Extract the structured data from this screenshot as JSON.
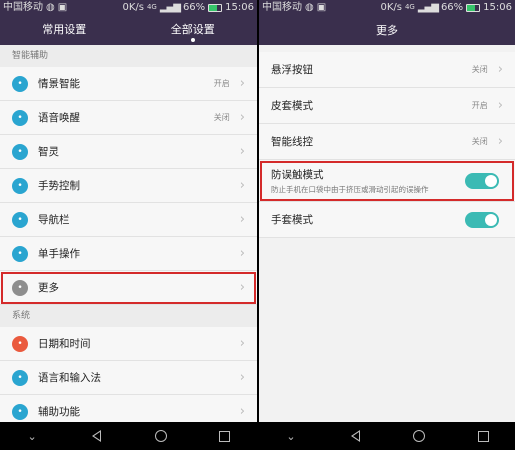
{
  "status": {
    "carrier": "中国移动",
    "speed": "0K/s",
    "network": "4G",
    "battery": "66%",
    "time": "15:06"
  },
  "left": {
    "tabs": [
      "常用设置",
      "全部设置"
    ],
    "section1": "智能辅助",
    "items1": [
      {
        "label": "情景智能",
        "value": "开启",
        "icon": "lightbulb-icon",
        "color": "#2aa5d0"
      },
      {
        "label": "语音唤醒",
        "value": "关闭",
        "icon": "voice-icon",
        "color": "#2aa5d0"
      },
      {
        "label": "智灵",
        "value": "",
        "icon": "assistant-icon",
        "color": "#2aa5d0"
      },
      {
        "label": "手势控制",
        "value": "",
        "icon": "gesture-icon",
        "color": "#2aa5d0"
      },
      {
        "label": "导航栏",
        "value": "",
        "icon": "navigation-icon",
        "color": "#2aa5d0"
      },
      {
        "label": "单手操作",
        "value": "",
        "icon": "one-hand-icon",
        "color": "#2aa5d0"
      },
      {
        "label": "更多",
        "value": "",
        "icon": "more-icon",
        "color": "#8e8e8e"
      }
    ],
    "section2": "系统",
    "items2": [
      {
        "label": "日期和时间",
        "value": "",
        "icon": "clock-icon",
        "color": "#ea5a3e"
      },
      {
        "label": "语言和输入法",
        "value": "",
        "icon": "keyboard-icon",
        "color": "#2aa5d0"
      },
      {
        "label": "辅助功能",
        "value": "",
        "icon": "accessibility-icon",
        "color": "#2aa5d0"
      }
    ]
  },
  "right": {
    "title": "更多",
    "items": [
      {
        "label": "悬浮按钮",
        "value": "关闭"
      },
      {
        "label": "皮套模式",
        "value": "开启"
      },
      {
        "label": "智能线控",
        "value": "关闭"
      }
    ],
    "toggle_items": [
      {
        "label": "防误触模式",
        "sub": "防止手机在口袋中由于挤压或滑动引起的误操作",
        "on": true
      },
      {
        "label": "手套模式",
        "sub": "",
        "on": true
      }
    ]
  }
}
